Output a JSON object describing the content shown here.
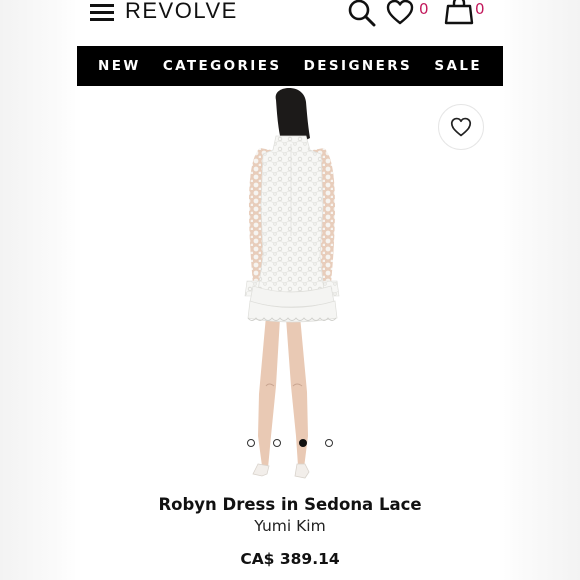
{
  "header": {
    "logo": "REVOLVE",
    "wishlist_count": "0",
    "bag_count": "0"
  },
  "nav": {
    "items": [
      "NEW",
      "CATEGORIES",
      "DESIGNERS",
      "SALE"
    ]
  },
  "product": {
    "name": "Robyn Dress in Sedona Lace",
    "designer": "Yumi Kim",
    "price": "CA$ 389.14",
    "image_count": 4,
    "active_image": 3
  },
  "colors": {
    "accent": "#c2185b",
    "nav_bg": "#000000",
    "dress": "#f6f6f4",
    "skin": "#e9c9b4"
  }
}
